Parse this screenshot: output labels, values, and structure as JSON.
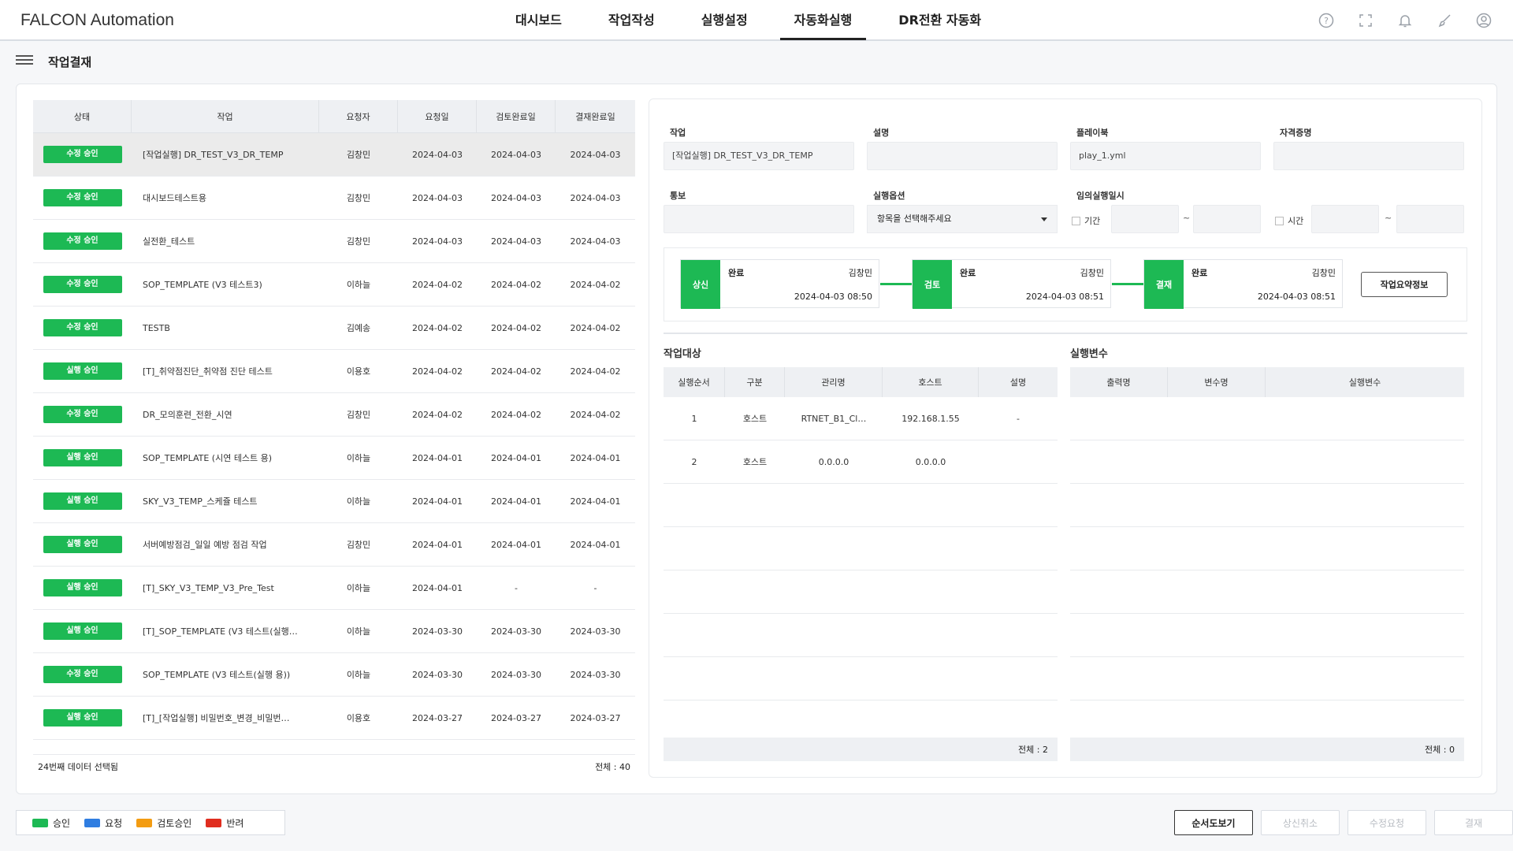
{
  "app": {
    "title": "FALCON Automation"
  },
  "nav": [
    {
      "label": "대시보드"
    },
    {
      "label": "작업작성"
    },
    {
      "label": "실행설정"
    },
    {
      "label": "자동화실행"
    },
    {
      "label": "DR전환 자동화"
    }
  ],
  "page": {
    "title": "작업결재"
  },
  "list": {
    "headers": [
      "상태",
      "작업",
      "요청자",
      "요청일",
      "검토완료일",
      "결재완료일"
    ],
    "rows": [
      {
        "status": "수정 승인",
        "task": "[작업실행] DR_TEST_V3_DR_TEMP",
        "requester": "김창민",
        "req_date": "2024-04-03",
        "review_date": "2024-04-03",
        "approve_date": "2024-04-03"
      },
      {
        "status": "수정 승인",
        "task": "대시보드테스트용",
        "requester": "김창민",
        "req_date": "2024-04-03",
        "review_date": "2024-04-03",
        "approve_date": "2024-04-03"
      },
      {
        "status": "수정 승인",
        "task": "실전환_테스트",
        "requester": "김창민",
        "req_date": "2024-04-03",
        "review_date": "2024-04-03",
        "approve_date": "2024-04-03"
      },
      {
        "status": "수정 승인",
        "task": "SOP_TEMPLATE (V3 테스트3)",
        "requester": "이하늘",
        "req_date": "2024-04-02",
        "review_date": "2024-04-02",
        "approve_date": "2024-04-02"
      },
      {
        "status": "수정 승인",
        "task": "TESTB",
        "requester": "김예송",
        "req_date": "2024-04-02",
        "review_date": "2024-04-02",
        "approve_date": "2024-04-02"
      },
      {
        "status": "실행 승인",
        "task": "[T]_취약점진단_취약점 진단 테스트",
        "requester": "이용호",
        "req_date": "2024-04-02",
        "review_date": "2024-04-02",
        "approve_date": "2024-04-02"
      },
      {
        "status": "수정 승인",
        "task": "DR_모의훈련_전환_시연",
        "requester": "김창민",
        "req_date": "2024-04-02",
        "review_date": "2024-04-02",
        "approve_date": "2024-04-02"
      },
      {
        "status": "실행 승인",
        "task": "SOP_TEMPLATE (시연 테스트 용)",
        "requester": "이하늘",
        "req_date": "2024-04-01",
        "review_date": "2024-04-01",
        "approve_date": "2024-04-01"
      },
      {
        "status": "실행 승인",
        "task": "SKY_V3_TEMP_스케쥴 테스트",
        "requester": "이하늘",
        "req_date": "2024-04-01",
        "review_date": "2024-04-01",
        "approve_date": "2024-04-01"
      },
      {
        "status": "실행 승인",
        "task": "서버예방점검_일일 예방 점검 작업",
        "requester": "김창민",
        "req_date": "2024-04-01",
        "review_date": "2024-04-01",
        "approve_date": "2024-04-01"
      },
      {
        "status": "실행 승인",
        "task": "[T]_SKY_V3_TEMP_V3_Pre_Test",
        "requester": "이하늘",
        "req_date": "2024-04-01",
        "review_date": "-",
        "approve_date": "-"
      },
      {
        "status": "실행 승인",
        "task": "[T]_SOP_TEMPLATE (V3 테스트(실행…",
        "requester": "이하늘",
        "req_date": "2024-03-30",
        "review_date": "2024-03-30",
        "approve_date": "2024-03-30"
      },
      {
        "status": "수정 승인",
        "task": "SOP_TEMPLATE (V3 테스트(실행 용))",
        "requester": "이하늘",
        "req_date": "2024-03-30",
        "review_date": "2024-03-30",
        "approve_date": "2024-03-30"
      },
      {
        "status": "실행 승인",
        "task": "[T]_[작업실행] 비밀번호_변경_비밀번…",
        "requester": "이용호",
        "req_date": "2024-03-27",
        "review_date": "2024-03-27",
        "approve_date": "2024-03-27"
      }
    ],
    "footer_left": "24번째 데이터 선택됨",
    "footer_right": "전체 : 40"
  },
  "detail": {
    "labels": {
      "task": "작업",
      "desc": "설명",
      "playbook": "플레이북",
      "credential": "자격증명",
      "notify": "통보",
      "exec_option": "실행옵션",
      "adhoc": "임의실행일시",
      "period": "기간",
      "time": "시간",
      "tilde": "~"
    },
    "values": {
      "task": "[작업실행] DR_TEST_V3_DR_TEMP",
      "desc": "",
      "playbook": "play_1.yml",
      "credential": "",
      "notify": "",
      "exec_option": "항목을 선택해주세요"
    },
    "steps": [
      {
        "kind": "상신",
        "status": "완료",
        "name": "김창민",
        "date": "2024-04-03 08:50"
      },
      {
        "kind": "검토",
        "status": "완료",
        "name": "김창민",
        "date": "2024-04-03 08:51"
      },
      {
        "kind": "결재",
        "status": "완료",
        "name": "김창민",
        "date": "2024-04-03 08:51"
      }
    ],
    "summary_btn": "작업요약정보",
    "targets": {
      "title": "작업대상",
      "headers": [
        "실행순서",
        "구분",
        "관리명",
        "호스트",
        "설명"
      ],
      "rows": [
        {
          "order": "1",
          "type": "호스트",
          "name": "RTNET_B1_Cl…",
          "host": "192.168.1.55",
          "desc": "-"
        },
        {
          "order": "2",
          "type": "호스트",
          "name": "0.0.0.0",
          "host": "0.0.0.0",
          "desc": ""
        }
      ],
      "total": "전체 : 2"
    },
    "vars": {
      "title": "실행변수",
      "headers": [
        "출력명",
        "변수명",
        "실행변수"
      ],
      "total": "전체 : 0"
    }
  },
  "legend": [
    {
      "label": "승인",
      "color": "#1db954"
    },
    {
      "label": "요청",
      "color": "#2f7de1"
    },
    {
      "label": "검토승인",
      "color": "#f39c12"
    },
    {
      "label": "반려",
      "color": "#e02d1f"
    }
  ],
  "buttons": {
    "sequence": "순서도보기",
    "cancel": "상신취소",
    "modify": "수정요청",
    "approve": "결재"
  },
  "icons": [
    "help-icon",
    "fullscreen-icon",
    "bell-icon",
    "brush-icon",
    "user-icon"
  ]
}
